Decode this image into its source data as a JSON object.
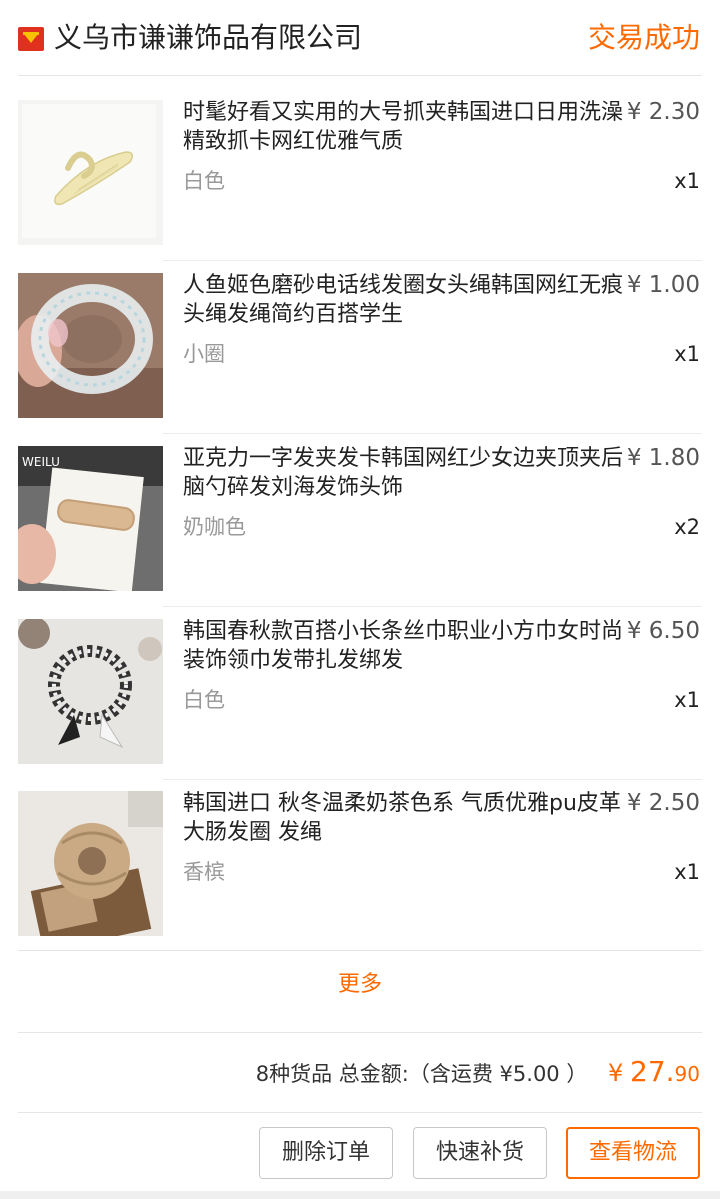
{
  "header": {
    "shop_name": "义乌市谦谦饰品有限公司",
    "order_status": "交易成功"
  },
  "items": [
    {
      "title": "时髦好看又实用的大号抓夹韩国进口日用洗澡精致抓卡网红优雅气质",
      "price": "¥ 2.30",
      "spec": "白色",
      "qty": "x1"
    },
    {
      "title": "人鱼姬色磨砂电话线发圈女头绳韩国网红无痕头绳发绳简约百搭学生",
      "price": "¥ 1.00",
      "spec": "小圈",
      "qty": "x1"
    },
    {
      "title": "亚克力一字发夹发卡韩国网红少女边夹顶夹后脑勺碎发刘海发饰头饰",
      "price": "¥ 1.80",
      "spec": "奶咖色",
      "qty": "x2",
      "thumb_text": "WEILU"
    },
    {
      "title": "韩国春秋款百搭小长条丝巾职业小方巾女时尚装饰领巾发带扎发绑发",
      "price": "¥ 6.50",
      "spec": "白色",
      "qty": "x1"
    },
    {
      "title": "韩国进口 秋冬温柔奶茶色系 气质优雅pu皮革大肠发圈 发绳",
      "price": "¥ 2.50",
      "spec": "香槟",
      "qty": "x1"
    }
  ],
  "more_label": "更多",
  "summary": {
    "text": "8种货品 总金额:（含运费 ¥5.00 ）",
    "total_currency": "¥",
    "total_integer": "27.",
    "total_decimal": "90"
  },
  "actions": {
    "delete_order": "删除订单",
    "quick_restock": "快速补货",
    "view_logistics": "查看物流"
  },
  "colors": {
    "accent": "#ff6a00",
    "shop_icon": "#e0301e"
  },
  "icons": {
    "shop": "shop-badge-icon"
  }
}
